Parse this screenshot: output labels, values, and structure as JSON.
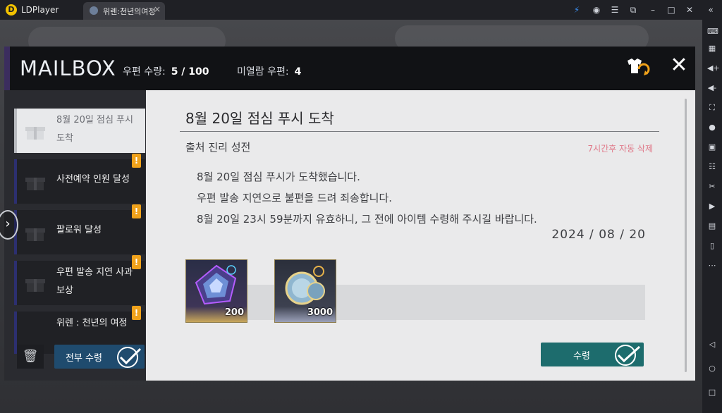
{
  "titlebar": {
    "app_name": "LDPlayer",
    "tab_title": "위렌:천년의여정",
    "tab_close": "×",
    "controls": [
      "sync-icon",
      "account-icon",
      "menu-icon",
      "screenshot-icon",
      "minimize-icon",
      "maximize-icon",
      "close-icon",
      "collapse-icon"
    ]
  },
  "mailbox": {
    "title": "MAILBOX",
    "count_label": "우편 수량:",
    "count_value": "5 / 100",
    "unread_label": "미열람 우편:",
    "unread_value": "4",
    "close_glyph": "✕"
  },
  "mail_list": [
    {
      "label": "8월 20일 점심 푸시 도착",
      "selected": true,
      "badge": ""
    },
    {
      "label": "사전예약 인원 달성",
      "selected": false,
      "badge": "!"
    },
    {
      "label": "팔로워 달성",
      "selected": false,
      "badge": "!"
    },
    {
      "label": "우편 발송 지연 사과 보상",
      "selected": false,
      "badge": "!"
    },
    {
      "label": "위렌 : 천년의 여정",
      "selected": false,
      "badge": "!"
    }
  ],
  "list_footer": {
    "claim_all_label": "전부 수령",
    "trash_icon": "trash-icon"
  },
  "detail": {
    "title": "8월 20일 점심 푸시 도착",
    "source": "출처 진리 성전",
    "expiry": "7시간후 자동 삭제",
    "body": [
      "8월 20일 점심 푸시가 도착했습니다.",
      "우편 발송 지연으로 불편을 드려 죄송합니다.",
      "8월 20일 23시 59분까지 유효하니, 그 전에 아이템 수령해 주시길 바랍니다."
    ],
    "date": "2024 / 08 / 20",
    "rewards": [
      {
        "icon": "crystal-icon",
        "count": "200"
      },
      {
        "icon": "coin-icon",
        "count": "3000"
      }
    ],
    "claim_label": "수령"
  },
  "colors": {
    "header_bg": "#111215",
    "list_bg": "#2a2b30",
    "detail_bg": "#eaeaeb",
    "claim_all_bg": "#1f4b6e",
    "claim_bg": "#1d6c6d",
    "badge": "#f0a21b",
    "expiry_text": "#e07a8a"
  }
}
